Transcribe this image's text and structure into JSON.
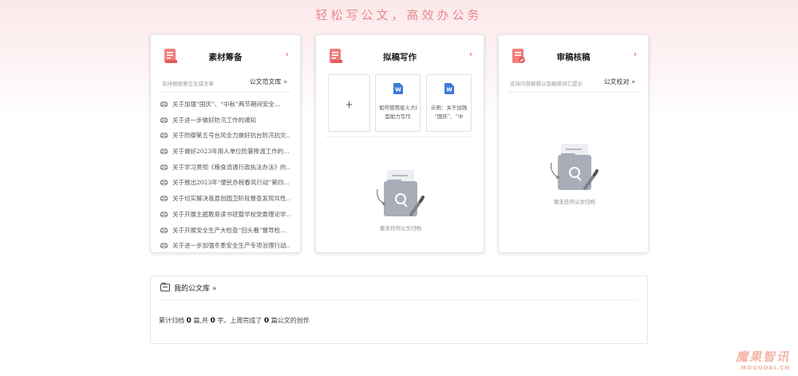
{
  "slogan": "轻松写公文，高效办公务",
  "material": {
    "title": "素材筹备",
    "hint": "支持根据意见生成文章",
    "link": "公文范文库 »",
    "items": [
      "关于加强“国庆”、“中秋”两节期间安全…",
      "关于进一步做好防汛工作的通知",
      "关于防御第五号台风全力做好抗台防汛抗灾…",
      "关于做好2023年用人单位防暑降温工作的通知",
      "关于学习贯彻《粮食流通行政执法办法》的…",
      "关于推出2023年“便民办税春风行动”第四…",
      "关于切实解决我县创园卫阶段督查发现共性…",
      "关于开展主题教育读书班暨学校党委理论学…",
      "关于开展安全生产大检查“回头看”督导检…",
      "关于进一步加强冬季安全生产专项治理行动…"
    ]
  },
  "drafting": {
    "title": "拟稿写作",
    "new_tile": "+",
    "tiles": [
      {
        "line1": "如何使用星火大模",
        "line2": "型助力写作"
      },
      {
        "line1": "示例：关于加强",
        "line2": "“国庆”、“中"
      }
    ],
    "empty_text": "暂无任何公文归档"
  },
  "review": {
    "title": "审稿核稿",
    "hint": "支持内容敏感以及敏感词汇提示",
    "link": "公文校对 »",
    "empty_text": "暂无任何公文归档"
  },
  "library": {
    "title": "我的公文库 »",
    "stats_prefix": "累计归档",
    "archived_count": "0",
    "stats_mid1": "篇,共",
    "word_count": "0",
    "stats_mid2": "字。上周完成了",
    "week_count": "0",
    "stats_suffix": "篇公文的创作"
  },
  "watermark": {
    "main": "魔果智讯",
    "sub": "MOGUOAI.CN"
  },
  "colors": {
    "accent": "#e8898c",
    "icon_red": "#e35c5c",
    "word_blue": "#3a7bd5"
  }
}
